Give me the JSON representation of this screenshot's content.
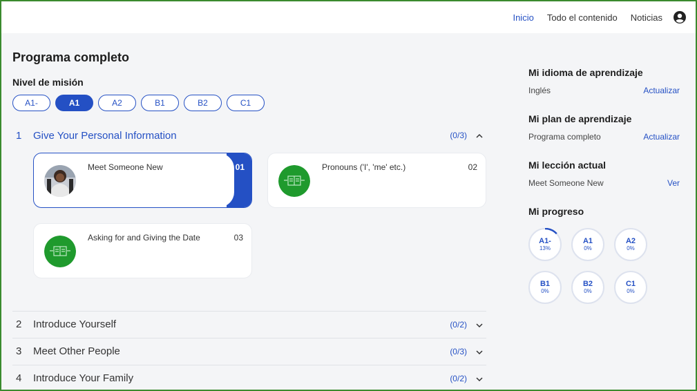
{
  "nav": {
    "items": [
      {
        "label": "Inicio",
        "active": true
      },
      {
        "label": "Todo el contenido",
        "active": false
      },
      {
        "label": "Noticias",
        "active": false
      }
    ],
    "account_icon": "account-circle-icon"
  },
  "main": {
    "title": "Programa completo",
    "level_label": "Nivel de misión",
    "levels": [
      {
        "label": "A1-",
        "active": false
      },
      {
        "label": "A1",
        "active": true
      },
      {
        "label": "A2",
        "active": false
      },
      {
        "label": "B1",
        "active": false
      },
      {
        "label": "B2",
        "active": false
      },
      {
        "label": "C1",
        "active": false
      }
    ],
    "units": [
      {
        "num": "1",
        "title": "Give Your Personal Information",
        "count": "(0/3)",
        "expanded": true,
        "lessons": [
          {
            "title": "Meet Someone New",
            "num": "01",
            "current": true,
            "thumb": "person-photo"
          },
          {
            "title": "Pronouns ('I', 'me' etc.)",
            "num": "02",
            "current": false,
            "thumb": "book-icon"
          },
          {
            "title": "Asking for and Giving the Date",
            "num": "03",
            "current": false,
            "thumb": "book-icon"
          }
        ]
      },
      {
        "num": "2",
        "title": "Introduce Yourself",
        "count": "(0/2)",
        "expanded": false
      },
      {
        "num": "3",
        "title": "Meet Other People",
        "count": "(0/3)",
        "expanded": false
      },
      {
        "num": "4",
        "title": "Introduce Your Family",
        "count": "(0/2)",
        "expanded": false
      }
    ]
  },
  "sidebar": {
    "language": {
      "heading": "Mi idioma de aprendizaje",
      "value": "Inglés",
      "link": "Actualizar"
    },
    "plan": {
      "heading": "Mi plan de aprendizaje",
      "value": "Programa completo",
      "link": "Actualizar"
    },
    "lesson": {
      "heading": "Mi lección actual",
      "value": "Meet Someone New",
      "link": "Ver"
    },
    "progress": {
      "heading": "Mi progreso",
      "levels": [
        {
          "label": "A1-",
          "percent": "13%",
          "fraction": 0.13
        },
        {
          "label": "A1",
          "percent": "0%",
          "fraction": 0
        },
        {
          "label": "A2",
          "percent": "0%",
          "fraction": 0
        },
        {
          "label": "B1",
          "percent": "0%",
          "fraction": 0
        },
        {
          "label": "B2",
          "percent": "0%",
          "fraction": 0
        },
        {
          "label": "C1",
          "percent": "0%",
          "fraction": 0
        }
      ]
    }
  },
  "colors": {
    "accent": "#2450c4",
    "thumb_green": "#1f9a2d",
    "frame_border": "#3a8a2e"
  }
}
